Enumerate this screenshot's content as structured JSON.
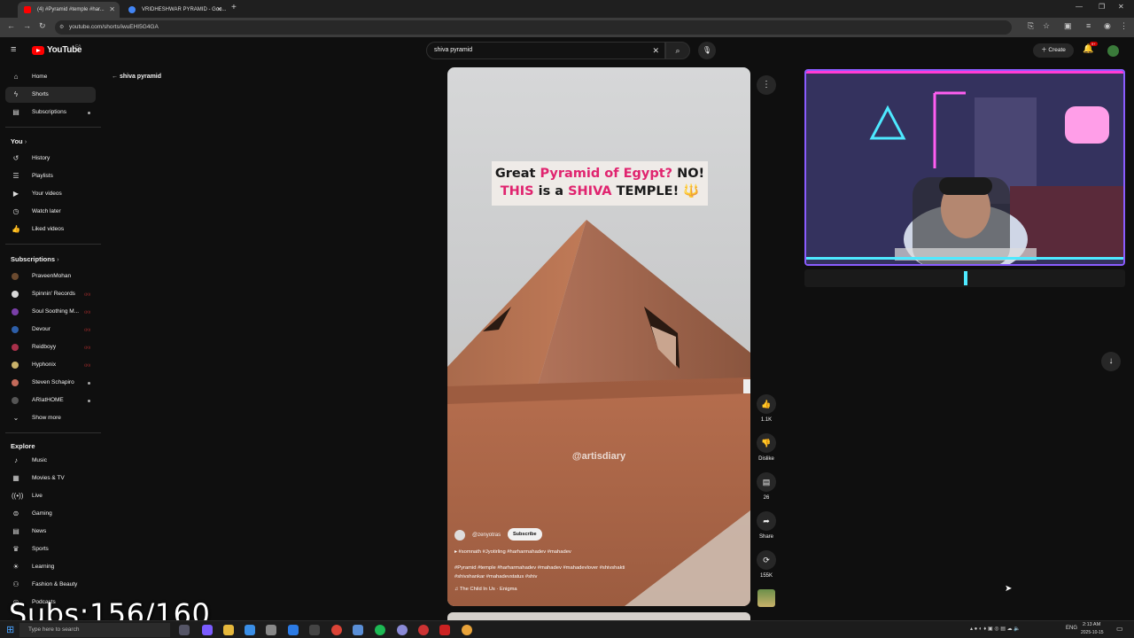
{
  "browser": {
    "tabs": [
      {
        "title": "(4) #Pyramid #temple #har...",
        "active": true
      },
      {
        "title": "VRIDHESHWAR PYRAMID - Goo...",
        "active": false
      }
    ],
    "url": "youtube.com/shorts/iwuEHI5G4GA",
    "new_tab": "+"
  },
  "header": {
    "logo": "YouTube",
    "region": "CA",
    "search_value": "shiva pyramid",
    "create_label": "Create",
    "notification_count": "9+"
  },
  "sidebar": {
    "main": [
      {
        "icon": "home-icon",
        "label": "Home"
      },
      {
        "icon": "shorts-icon",
        "label": "Shorts",
        "active": true
      },
      {
        "icon": "subscriptions-icon",
        "label": "Subscriptions"
      }
    ],
    "you_heading": "You",
    "you_items": [
      {
        "icon": "history-icon",
        "label": "History"
      },
      {
        "icon": "playlists-icon",
        "label": "Playlists"
      },
      {
        "icon": "your-videos-icon",
        "label": "Your videos"
      },
      {
        "icon": "watch-later-icon",
        "label": "Watch later"
      },
      {
        "icon": "liked-icon",
        "label": "Liked videos"
      }
    ],
    "subs_heading": "Subscriptions",
    "subs": [
      {
        "label": "PraveenMohan",
        "color": "#6b4a2f"
      },
      {
        "label": "Spinnin' Records",
        "color": "#d9d9d9"
      },
      {
        "label": "Soul Soothing M...",
        "color": "#7a3fa8"
      },
      {
        "label": "Devour",
        "color": "#2d5ea8"
      },
      {
        "label": "Reidboyy",
        "color": "#a8304a"
      },
      {
        "label": "Hyphonix",
        "color": "#c9b26a"
      },
      {
        "label": "Steven Schapiro",
        "color": "#c36a5a"
      },
      {
        "label": "ARIatHOME",
        "color": "#555555"
      }
    ],
    "show_more": "Show more",
    "explore_heading": "Explore",
    "explore": [
      {
        "icon": "music-icon",
        "label": "Music"
      },
      {
        "icon": "movies-icon",
        "label": "Movies & TV"
      },
      {
        "icon": "live-icon",
        "label": "Live"
      },
      {
        "icon": "gaming-icon",
        "label": "Gaming"
      },
      {
        "icon": "news-icon",
        "label": "News"
      },
      {
        "icon": "sports-icon",
        "label": "Sports"
      },
      {
        "icon": "learning-icon",
        "label": "Learning"
      },
      {
        "icon": "fashion-icon",
        "label": "Fashion & Beauty"
      },
      {
        "icon": "podcasts-icon",
        "label": "Podcasts"
      }
    ]
  },
  "search_back": "shiva pyramid",
  "short": {
    "caption_line1_a": "Great ",
    "caption_line1_b": "Pyramid of Egypt?",
    "caption_line1_c": " NO!",
    "caption_line2_a": "THIS",
    "caption_line2_b": " is a ",
    "caption_line2_c": "SHIVA",
    "caption_line2_d": " TEMPLE! 🔱",
    "watermark": "@artisdiary",
    "channel": "@zenyotras",
    "subscribe": "Subscribe",
    "tags_line": "#somnath #Jyotirling #harharmahadev #mahadev",
    "desc_line1": "#Pyramid #temple #harharmahadev #mahadev #mahadevlover #shivshakti",
    "desc_line2": "#shivshankar #mahadevstatus #shiv",
    "music": "The Child In Us · Enigma"
  },
  "actions": {
    "likes": "1.1K",
    "dislike": "Dislike",
    "comments": "26",
    "share": "Share",
    "remix": "155K"
  },
  "overlay": {
    "subs_counter": "Subs:156/160"
  },
  "taskbar": {
    "search_placeholder": "Type here to search",
    "lang": "ENG",
    "time": "2:13 AM",
    "date": "2025-10-15"
  }
}
